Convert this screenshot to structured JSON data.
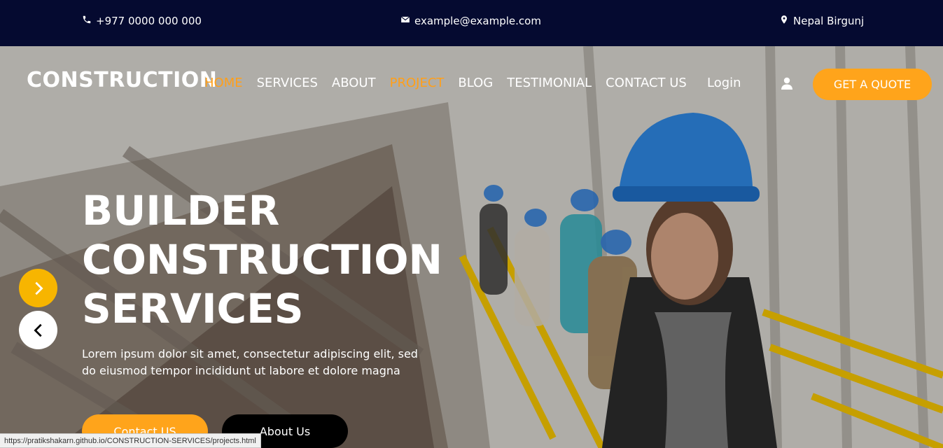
{
  "topbar": {
    "phone": "+977 0000 000 000",
    "email": "example@example.com",
    "location": "Nepal Birgunj",
    "icons": [
      "phone-icon",
      "envelope-icon",
      "map-marker-icon"
    ],
    "background": "#050a30"
  },
  "nav": {
    "logo": "CONSTRUCTION",
    "items": [
      {
        "label": "HOME",
        "active": true
      },
      {
        "label": "SERVICES",
        "active": false
      },
      {
        "label": "ABOUT",
        "active": false
      },
      {
        "label": "PROJECT",
        "active": true
      },
      {
        "label": "BLOG",
        "active": false
      },
      {
        "label": "TESTIMONIAL",
        "active": false
      },
      {
        "label": "CONTACT US",
        "active": false
      }
    ],
    "login": "Login",
    "user_icon": "user-icon",
    "quote_button": "GET A QUOTE",
    "accent": "#ffa41b"
  },
  "hero": {
    "title_lines": [
      "BUILDER",
      "CONSTRUCTION",
      "SERVICES"
    ],
    "subtitle": "Lorem ipsum dolor sit amet, consectetur adipiscing elit, sed do eiusmod tempor incididunt ut labore et dolore magna",
    "contact_button": "Contact US",
    "about_button": "About Us",
    "next_icon": "chevron-right-icon",
    "prev_icon": "chevron-left-icon"
  },
  "status": {
    "url": "https://pratikshakarn.github.io/CONSTRUCTION-SERVICES/projects.html"
  }
}
